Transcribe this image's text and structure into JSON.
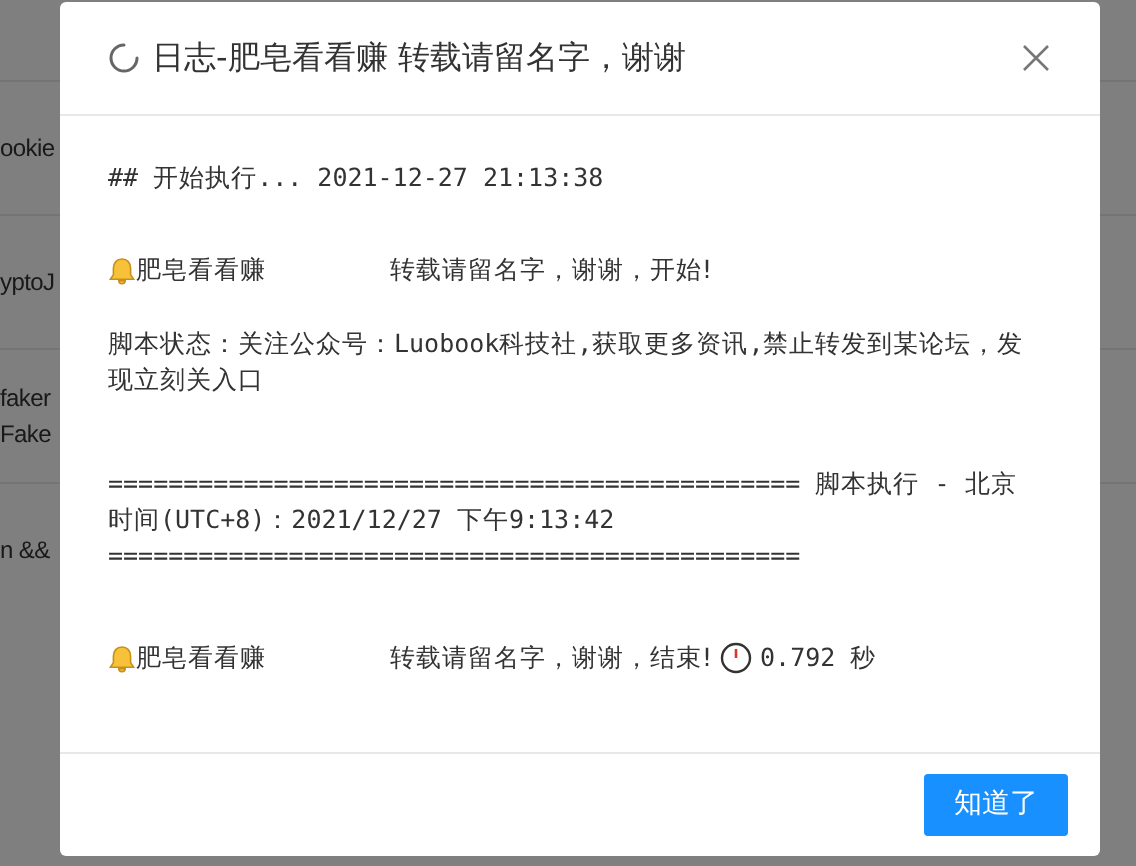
{
  "background_rows": [
    {
      "text": "ookie"
    },
    {
      "text": "yptoJ"
    },
    {
      "text": "faker",
      "text_2": "Fake"
    },
    {
      "text": "n &&"
    }
  ],
  "dialog": {
    "title": "日志-肥皂看看赚 转载请留名字，谢谢",
    "log": [
      {
        "kind": "text",
        "text": "## 开始执行... 2021-12-27 21:13:38"
      },
      {
        "kind": "notify",
        "name": "肥皂看看赚",
        "message": "转载请留名字，谢谢，开始!"
      },
      {
        "kind": "text",
        "text": "脚本状态：关注公众号：Luobook科技社,获取更多资讯,禁止转发到某论坛，发现立刻关入口"
      },
      {
        "kind": "text",
        "text": "============================================== 脚本执行 - 北京时间(UTC+8)：2021/12/27 下午9:13:42 =============================================="
      },
      {
        "kind": "notify",
        "name": "肥皂看看赚",
        "message": "转载请留名字，谢谢，结束!",
        "duration": "0.792 秒"
      }
    ],
    "ok_button": "知道了"
  }
}
